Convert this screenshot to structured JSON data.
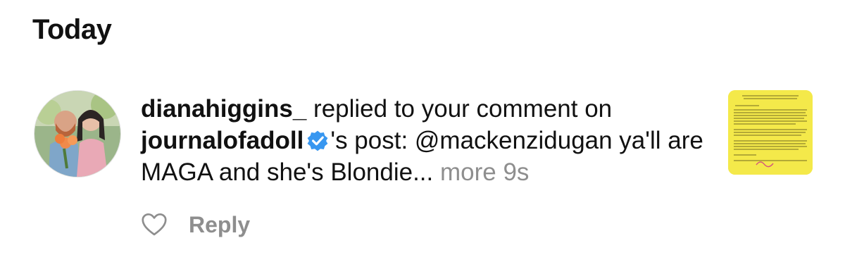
{
  "section": {
    "title": "Today"
  },
  "notification": {
    "username": "dianahiggins_",
    "action_text": " replied to your comment on ",
    "post_owner": "journalofadoll",
    "post_suffix": "'s post: @mackenzidugan ya'll are MAGA and she's Blondie...",
    "more_label": "more",
    "timestamp": "9s",
    "verified_badge_color": "#3897f0",
    "avatar_icon": "avatar-photo",
    "thumbnail_color": "#f4e94a"
  },
  "actions": {
    "like_icon": "heart-outline-icon",
    "reply_label": "Reply"
  }
}
